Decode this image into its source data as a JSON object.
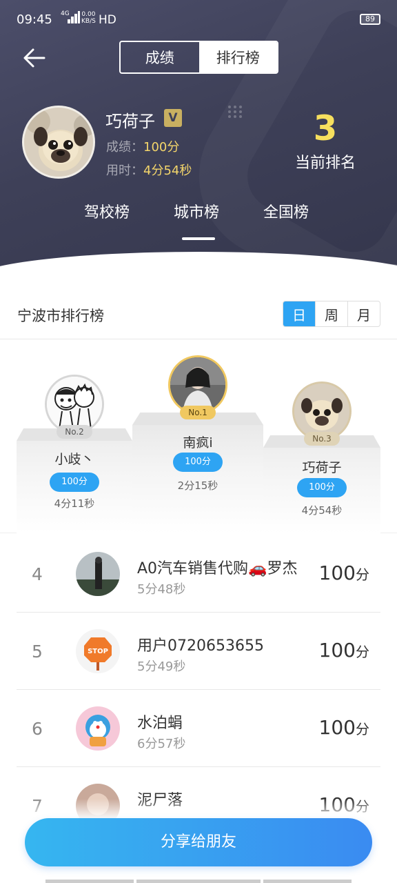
{
  "status": {
    "time": "09:45",
    "network": "4G",
    "speed_value": "0.00",
    "speed_unit": "KB/S",
    "hd": "HD",
    "battery": "89"
  },
  "header": {
    "tabs": [
      {
        "label": "成绩"
      },
      {
        "label": "排行榜"
      }
    ],
    "active_tab": 1
  },
  "profile": {
    "name": "巧荷子",
    "vip_label": "V",
    "score_label": "成绩：",
    "score_value": "100分",
    "time_label": "用时：",
    "time_value": "4分54秒",
    "rank": "3",
    "rank_label": "当前排名"
  },
  "board_tabs": [
    {
      "label": "驾校榜"
    },
    {
      "label": "城市榜"
    },
    {
      "label": "全国榜"
    }
  ],
  "board_active": 1,
  "city": {
    "title": "宁波市排行榜",
    "periods": [
      {
        "label": "日"
      },
      {
        "label": "周"
      },
      {
        "label": "月"
      }
    ],
    "active_period": 0
  },
  "podium": [
    {
      "badge": "No.2",
      "name": "小歧丶",
      "score": "100分",
      "time": "4分11秒"
    },
    {
      "badge": "No.1",
      "name": "南疯i",
      "score": "100分",
      "time": "2分15秒"
    },
    {
      "badge": "No.3",
      "name": "巧荷子",
      "score": "100分",
      "time": "4分54秒"
    }
  ],
  "list": [
    {
      "rank": "4",
      "name": "A0汽车销售代购🚗罗杰",
      "time": "5分48秒",
      "score": "100",
      "unit": "分"
    },
    {
      "rank": "5",
      "name": "用户0720653655",
      "time": "5分49秒",
      "score": "100",
      "unit": "分"
    },
    {
      "rank": "6",
      "name": "水泊蜎",
      "time": "6分57秒",
      "score": "100",
      "unit": "分"
    },
    {
      "rank": "7",
      "name": "泥尸落",
      "time": "",
      "score": "100",
      "unit": "分"
    }
  ],
  "share_label": "分享给朋友",
  "colors": {
    "header_bg": "#3e4058",
    "accent_blue": "#2ea4f3",
    "rank_yellow": "#f6df5e",
    "gold_badge": "#f0c860",
    "silver_badge": "#d0d0d0"
  }
}
